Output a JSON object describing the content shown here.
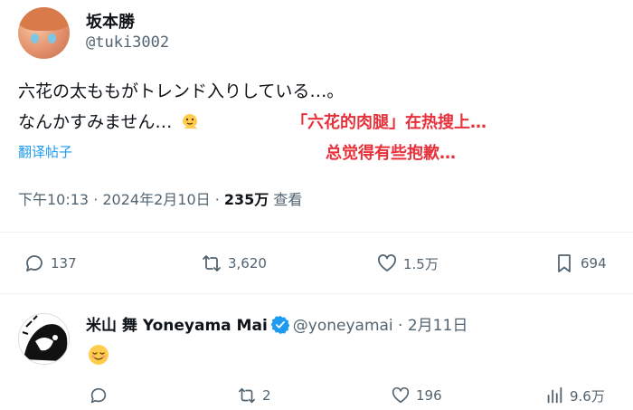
{
  "tweet": {
    "author_name": "坂本勝",
    "author_handle": "@tuki3002",
    "text_line1": "六花の太ももがトレンド入りしている…。",
    "text_line2": "なんかすみません…",
    "overlay_caption_line1": "「六花的肉腿」在热搜上…",
    "overlay_caption_line2": "总觉得有些抱歉…",
    "translate_label": "翻译帖子",
    "time": "下午10:13 · 2024年2月10日 · ",
    "views_count": "235万",
    "views_label": " 查看",
    "stats": {
      "replies": "137",
      "retweets": "3,620",
      "likes": "1.5万",
      "bookmarks": "694"
    }
  },
  "reply": {
    "author_name": "米山 舞 Yoneyama Mai",
    "author_handle": "@yoneyamai · 2月11日",
    "stats": {
      "replies": "",
      "retweets": "2",
      "likes": "196",
      "views": "9.6万"
    }
  },
  "colors": {
    "accent": "#1d9bf0",
    "caption_red": "#e8303a",
    "muted": "#536471"
  }
}
